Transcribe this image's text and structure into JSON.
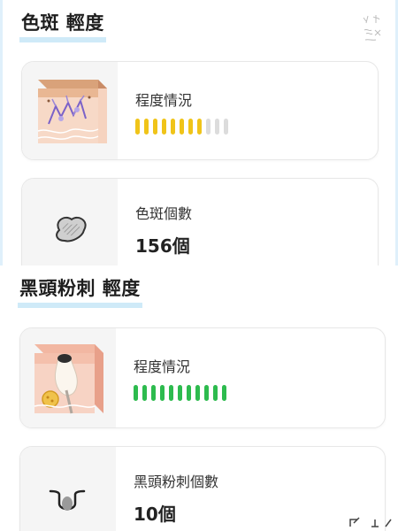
{
  "spots": {
    "title": "色斑 輕度",
    "severity_label": "程度情況",
    "severity": {
      "filled": 8,
      "total": 11,
      "color": "#f0c419",
      "empty_color": "#dcdcdc"
    },
    "count_label": "色斑個數",
    "count_value": "156個",
    "image_icon": "skin-pigment-illustration",
    "count_icon": "spot-icon"
  },
  "blackheads": {
    "title": "黑頭粉刺 輕度",
    "severity_label": "程度情況",
    "severity": {
      "filled": 11,
      "total": 11,
      "color": "#2dbb4e",
      "empty_color": "#dcdcdc"
    },
    "count_label": "黑頭粉刺個數",
    "count_value": "10個",
    "image_icon": "skin-pore-illustration",
    "count_icon": "pore-icon"
  }
}
